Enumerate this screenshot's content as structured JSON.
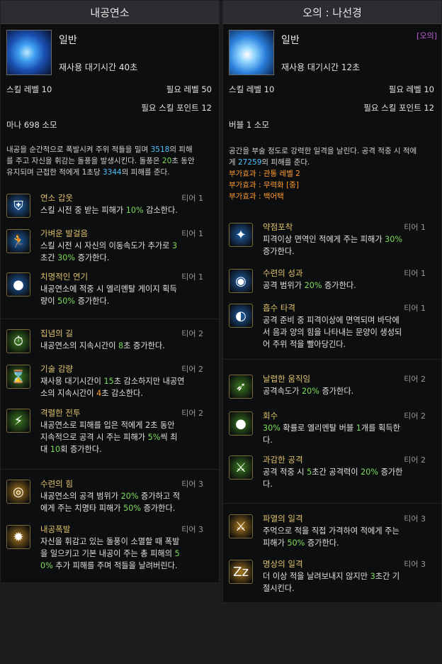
{
  "left": {
    "title": "내공연소",
    "grade": "일반",
    "cooldown": "재사용 대기시간 40초",
    "skill_level": "스킬 레벨 10",
    "req_level": "필요 레벨 50",
    "req_points": "필요 스킬 포인트 12",
    "cost": "마나 698 소모",
    "desc": [
      [
        {
          "t": "내공을 순간적으로 폭발시켜 주위 적들을 밀며 "
        },
        {
          "t": "3518",
          "c": "hl"
        },
        {
          "t": "의 피해"
        }
      ],
      [
        {
          "t": "를 주고 자신을 휘감는 돌풍을 발생시킨다. 돌풍은 "
        },
        {
          "t": "20",
          "c": "g"
        },
        {
          "t": "초 동안"
        }
      ],
      [
        {
          "t": "유지되며 근접한 적에게 1초당 "
        },
        {
          "t": "3344",
          "c": "hl"
        },
        {
          "t": "의 피해를 준다."
        }
      ]
    ],
    "tripods": [
      {
        "icon": "⛨",
        "name": "연소 갑옷",
        "tier": "티어 1",
        "lines": [
          [
            {
              "t": "스킬 시전 중 받는 피해가 "
            },
            {
              "t": "10%",
              "c": "g"
            },
            {
              "t": " 감소한다."
            }
          ]
        ]
      },
      {
        "icon": "🏃",
        "name": "가벼운 발걸음",
        "tier": "티어 1",
        "lines": [
          [
            {
              "t": "스킬 시전 시 자신의 이동속도가 추가로 "
            },
            {
              "t": "3",
              "c": "g"
            }
          ],
          [
            {
              "t": "초간 "
            },
            {
              "t": "30%",
              "c": "g"
            },
            {
              "t": " 증가한다."
            }
          ]
        ]
      },
      {
        "icon": "●",
        "name": "치명적인 연기",
        "tier": "티어 1",
        "lines": [
          [
            {
              "t": "내공연소에 적중 시 엘리멘탈 게이지 획득"
            }
          ],
          [
            {
              "t": "량이 "
            },
            {
              "t": "50%",
              "c": "g"
            },
            {
              "t": " 증가한다."
            }
          ]
        ]
      },
      {
        "icon": "⏱",
        "name": "집념의 길",
        "tier": "티어 2",
        "lines": [
          [
            {
              "t": "내공연소의 지속시간이 "
            },
            {
              "t": "8",
              "c": "g"
            },
            {
              "t": "초 증가한다."
            }
          ]
        ]
      },
      {
        "icon": "⌛",
        "name": "기술 감량",
        "tier": "티어 2",
        "lines": [
          [
            {
              "t": "재사용 대기시간이 "
            },
            {
              "t": "15",
              "c": "g"
            },
            {
              "t": "초 감소하지만 내공연"
            }
          ],
          [
            {
              "t": "소의 지속시간이 "
            },
            {
              "t": "4",
              "c": "o"
            },
            {
              "t": "초 감소한다."
            }
          ]
        ]
      },
      {
        "icon": "⚡",
        "name": "격렬한 전투",
        "tier": "티어 2",
        "lines": [
          [
            {
              "t": "내공연소로 피해를 입은 적에게 2초 동안"
            }
          ],
          [
            {
              "t": "지속적으로 공격 시 주는 피해가 "
            },
            {
              "t": "5%",
              "c": "g"
            },
            {
              "t": "씩 최"
            }
          ],
          [
            {
              "t": "대 "
            },
            {
              "t": "10",
              "c": "g"
            },
            {
              "t": "회 증가한다."
            }
          ]
        ]
      },
      {
        "icon": "◎",
        "name": "수련의 힘",
        "tier": "티어 3",
        "lines": [
          [
            {
              "t": "내공연소의 공격 범위가 "
            },
            {
              "t": "20%",
              "c": "g"
            },
            {
              "t": " 증가하고 적"
            }
          ],
          [
            {
              "t": "에게 주는 치명타 피해가 "
            },
            {
              "t": "50%",
              "c": "g"
            },
            {
              "t": " 증가한다."
            }
          ]
        ]
      },
      {
        "icon": "✹",
        "name": "내공폭발",
        "tier": "티어 3",
        "lines": [
          [
            {
              "t": "자신을 휘감고 있는 돌풍이 소멸할 때 폭발"
            }
          ],
          [
            {
              "t": "을 일으키고 기본 내공이 주는 총 피해의 "
            },
            {
              "t": "5",
              "c": "g"
            }
          ],
          [
            {
              "t": "0%",
              "c": "g"
            },
            {
              "t": " 추가 피해를 주며 적들을 날려버린다."
            }
          ]
        ]
      }
    ]
  },
  "right": {
    "title": "오의 : 나선경",
    "grade": "일반",
    "tag": "[오의]",
    "cooldown": "재사용 대기시간 12초",
    "skill_level": "스킬 레벨 10",
    "req_level": "필요 레벨 10",
    "req_points": "필요 스킬 포인트 12",
    "cost": "버블 1 소모",
    "desc": [
      [
        {
          "t": "공간을 부술 정도로 강력한 일격을 날린다. 공격 적중 시 적에"
        }
      ],
      [
        {
          "t": "게 "
        },
        {
          "t": "27259",
          "c": "hl"
        },
        {
          "t": "의 피해를 준다."
        }
      ],
      [
        {
          "t": "부가효과 : 관통 레벨 2",
          "c": "o"
        }
      ],
      [
        {
          "t": "부가효과 : 무력화 [중]",
          "c": "o"
        }
      ],
      [
        {
          "t": "부가효과 : 백어택",
          "c": "o"
        }
      ]
    ],
    "tripods": [
      {
        "icon": "✦",
        "name": "약점포착",
        "tier": "티어 1",
        "lines": [
          [
            {
              "t": "피격이상 면역인 적에게 주는 피해가 "
            },
            {
              "t": "30%",
              "c": "g"
            }
          ],
          [
            {
              "t": "증가한다."
            }
          ]
        ]
      },
      {
        "icon": "◉",
        "name": "수련의 성과",
        "tier": "티어 1",
        "lines": [
          [
            {
              "t": "공격 범위가 "
            },
            {
              "t": "20%",
              "c": "g"
            },
            {
              "t": " 증가한다."
            }
          ]
        ]
      },
      {
        "icon": "◐",
        "name": "흡수 타격",
        "tier": "티어 1",
        "lines": [
          [
            {
              "t": "공격 준비 중 피격이상에 면역되며 바닥에"
            }
          ],
          [
            {
              "t": "서 음과 양의 힘을 나타내는 문양이 생성되"
            }
          ],
          [
            {
              "t": "어 주위 적을 빨아당긴다."
            }
          ]
        ]
      },
      {
        "icon": "➶",
        "name": "날렵한 움직임",
        "tier": "티어 2",
        "lines": [
          [
            {
              "t": "공격속도가 "
            },
            {
              "t": "20%",
              "c": "g"
            },
            {
              "t": " 증가한다."
            }
          ]
        ]
      },
      {
        "icon": "●",
        "name": "회수",
        "tier": "티어 2",
        "lines": [
          [
            {
              "t": "30%",
              "c": "g"
            },
            {
              "t": " 확률로 엘리멘탈 버블 "
            },
            {
              "t": "1",
              "c": "g"
            },
            {
              "t": "개를 획득한"
            }
          ],
          [
            {
              "t": "다."
            }
          ]
        ]
      },
      {
        "icon": "⚔",
        "name": "과감한 공격",
        "tier": "티어 2",
        "lines": [
          [
            {
              "t": "공격 적중 시 "
            },
            {
              "t": "5",
              "c": "g"
            },
            {
              "t": "초간 공격력이 "
            },
            {
              "t": "20%",
              "c": "g"
            },
            {
              "t": " 증가한"
            }
          ],
          [
            {
              "t": "다."
            }
          ]
        ]
      },
      {
        "icon": "⚔",
        "name": "파열의 일격",
        "tier": "티어 3",
        "lines": [
          [
            {
              "t": "주먹으로 적을 직접 가격하여 적에게 주는"
            }
          ],
          [
            {
              "t": "피해가 "
            },
            {
              "t": "50%",
              "c": "g"
            },
            {
              "t": " 증가한다."
            }
          ]
        ]
      },
      {
        "icon": "Zz",
        "name": "명상의 일격",
        "tier": "티어 3",
        "lines": [
          [
            {
              "t": "더 이상 적을 날려보내지 않지만 "
            },
            {
              "t": "3",
              "c": "g"
            },
            {
              "t": "초간 기"
            }
          ],
          [
            {
              "t": "절시킨다."
            }
          ]
        ]
      }
    ]
  },
  "colors": {
    "hl": "#4dc3ff",
    "g": "#7ddc5a",
    "o": "#ff9a2e",
    "tier_name": "#e0c36a",
    "tag": "#c25bd6"
  }
}
